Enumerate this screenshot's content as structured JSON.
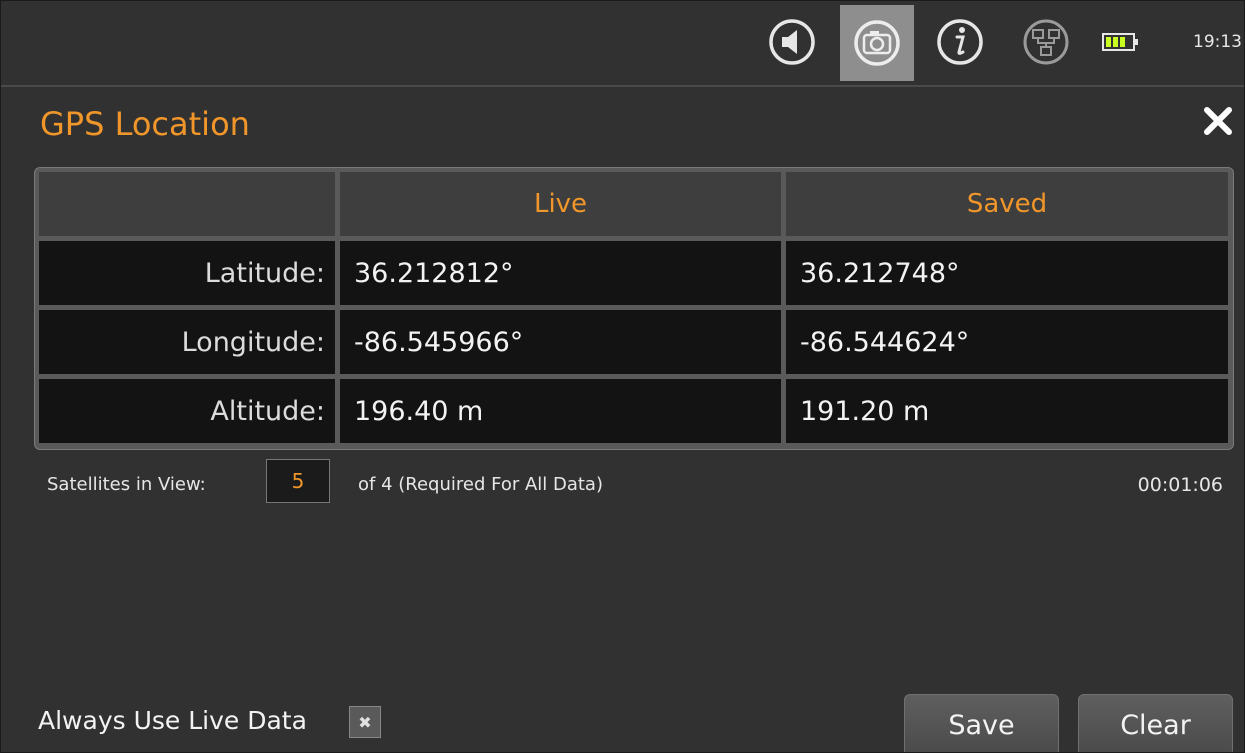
{
  "status_bar": {
    "icons": [
      {
        "name": "volume-icon"
      },
      {
        "name": "camera-icon",
        "active": true
      },
      {
        "name": "info-icon"
      },
      {
        "name": "network-icon"
      },
      {
        "name": "battery-icon"
      }
    ],
    "battery_level_fraction": 0.75,
    "clock": "19:13"
  },
  "dialog": {
    "title": "GPS Location",
    "close_icon": "close-icon"
  },
  "table": {
    "columns": [
      "",
      "Live",
      "Saved"
    ],
    "rows": [
      {
        "label": "Latitude:",
        "live": "36.212812°",
        "saved": "36.212748°"
      },
      {
        "label": "Longitude:",
        "live": "-86.545966°",
        "saved": "-86.544624°"
      },
      {
        "label": "Altitude:",
        "live": "196.40 m",
        "saved": "191.20 m"
      }
    ]
  },
  "satellites": {
    "label": "Satellites in View:",
    "count": "5",
    "requirement": "of 4 (Required For All Data)",
    "elapsed": "00:01:06"
  },
  "footer": {
    "always_live_label": "Always Use Live Data",
    "always_live_checked": true,
    "checkbox_mark": "✖",
    "save_label": "Save",
    "clear_label": "Clear"
  },
  "colors": {
    "accent": "#f0962a",
    "background": "#313131",
    "cell_background": "#131313"
  }
}
